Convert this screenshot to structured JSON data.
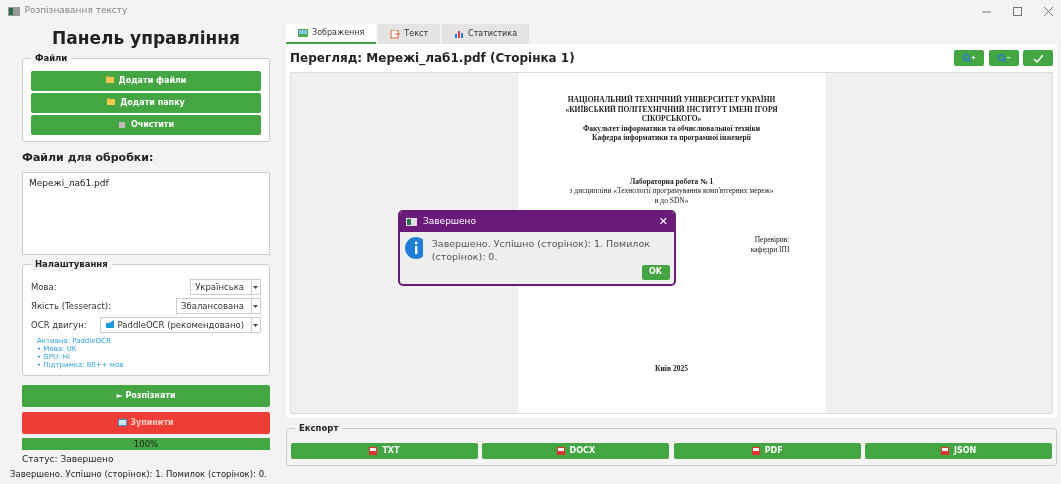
{
  "window": {
    "title": "Розпізнавання тексту"
  },
  "control_panel": {
    "title": "Панель управління",
    "files_group": {
      "title": "Файли",
      "buttons": [
        {
          "label": "Додати файли",
          "kind": "add"
        },
        {
          "label": "Додати папку",
          "kind": "add"
        },
        {
          "label": "Очистити",
          "kind": "clear"
        }
      ]
    },
    "file_list_title": "Файли для обробки:",
    "files": [
      {
        "name": "Мережі_лаб1.pdf",
        "selected": false
      }
    ],
    "settings": {
      "title": "Налаштування",
      "fields": [
        {
          "label": "Мова:",
          "value": "Українська",
          "icon": false
        },
        {
          "label": "Якість (Tesseract):",
          "value": "Збалансована",
          "icon": false
        },
        {
          "label": "OCR двигун:",
          "value": "PaddleOCR (рекомендовано)",
          "icon": true
        }
      ],
      "engine_info": [
        "Активна: PaddleOCR",
        "• Мова: UK",
        "• GPU: Ні",
        "• Підтримка: 80++ мов"
      ]
    },
    "recognize_button": "► Розпізнати",
    "stop_button": "Зупинити",
    "progress": {
      "level": 1,
      "label": "100%"
    },
    "status": "Статус: Завершено"
  },
  "tabs": [
    {
      "label": "Зображення",
      "selected": true
    },
    {
      "label": "Текст",
      "selected": false
    },
    {
      "label": "Статистика",
      "selected": false
    }
  ],
  "preview": {
    "title": "Перегляд: Мережі_лаб1.pdf (Сторінка 1)",
    "page_lines": [
      {
        "text": "НАЦІОНАЛЬНИЙ ТЕХНІЧНИЙ УНІВЕРСИТЕТ УКРАЇНИ",
        "kind": "head"
      },
      {
        "text": "«КИЇВСЬКИЙ ПОЛІТЕХНІЧНИЙ ІНСТИТУТ ІМЕНІ ІГОРЯ",
        "kind": "head"
      },
      {
        "text": "СІКОРСЬКОГО»",
        "kind": "head"
      },
      {
        "text": "Факультет інформатики та обчислювальної техніки",
        "kind": "head"
      },
      {
        "text": "Кафедра інформатики та програмної інженерії",
        "kind": "head"
      },
      {
        "text": "Лабораторна робота № 1",
        "kind": "gap"
      },
      {
        "text": "з дисципліни «Технології програмування комп'ютерних мереж»",
        "kind": "plain"
      },
      {
        "text": "и до SDN»",
        "kind": "plain"
      },
      {
        "text": "Перевірив:",
        "kind": "right"
      },
      {
        "text": "кафедри ІПІ",
        "kind": "right"
      },
      {
        "text": "Київ 2025",
        "kind": "foot"
      }
    ]
  },
  "export": {
    "title": "Експорт",
    "buttons": [
      "TXT",
      "DOCX",
      "PDF",
      "JSON"
    ]
  },
  "message": "Завершено. Успішно (сторінок): 1. Помилок (сторінок): 0.",
  "dialog": {
    "title": "Завершено",
    "close": "✕",
    "text": "Завершено. Успішно (сторінок): 1. Помилок (сторінок): 0.",
    "button": "OK"
  }
}
